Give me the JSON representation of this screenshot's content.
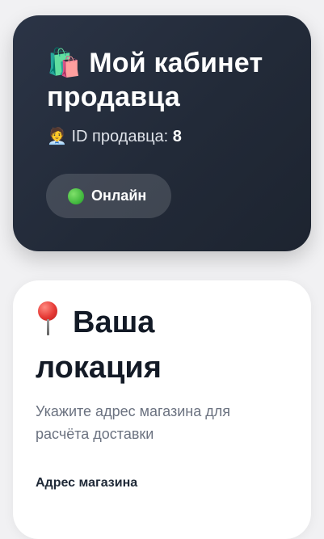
{
  "header": {
    "icon": "shopping-bags-icon",
    "icon_glyph": "🛍️",
    "title": "Мой кабинет продавца",
    "seller_icon": "office-worker-icon",
    "seller_icon_glyph": "🧑‍💼",
    "seller_id_label": "ID продавца:",
    "seller_id_value": "8",
    "status": {
      "label": "Онлайн",
      "dot_color": "#3cb43a"
    }
  },
  "location": {
    "icon": "pin-icon",
    "title": "Ваша локация",
    "subtitle": "Укажите адрес магазина для расчёта доставки",
    "address_label": "Адрес магазина"
  }
}
